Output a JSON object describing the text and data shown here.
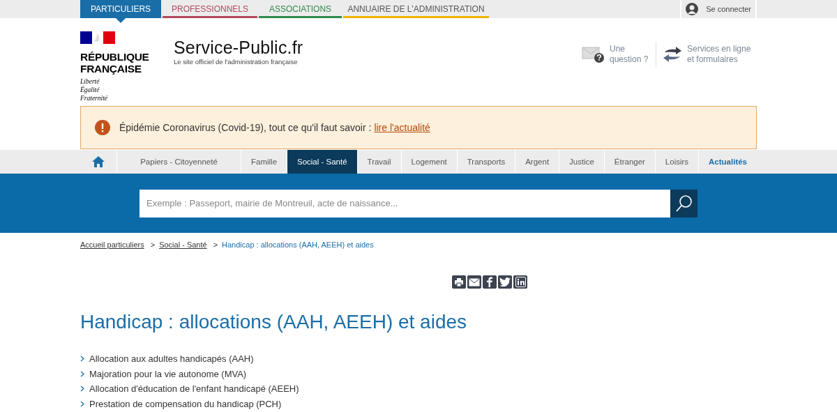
{
  "audience_tabs": [
    {
      "label": "PARTICULIERS",
      "selected": true,
      "color": "#1a6ea8"
    },
    {
      "label": "PROFESSIONNELS",
      "selected": false,
      "color": "#b5475e"
    },
    {
      "label": "ASSOCIATIONS",
      "selected": false,
      "color": "#2e8b4c"
    },
    {
      "label": "ANNUAIRE DE L'ADMINISTRATION",
      "selected": false,
      "color": "#f0b400",
      "kind": "neutral"
    }
  ],
  "login": {
    "label": "Se connecter"
  },
  "logo": {
    "republic": [
      "RÉPUBLIQUE",
      "FRANÇAISE"
    ],
    "motto": [
      "Liberté",
      "Égalité",
      "Fraternité"
    ]
  },
  "site": {
    "name": "Service-Public",
    "tld": ".fr",
    "tagline": "Le site officiel de l'administration française"
  },
  "header_links": [
    {
      "kind": "question",
      "label": "Une question ?"
    },
    {
      "kind": "services",
      "label": "Services en ligne et formulaires"
    }
  ],
  "alert": {
    "text": "Épidémie Coronavirus (Covid-19), tout ce qu'il faut savoir :",
    "link": "lire l'actualité"
  },
  "nav": [
    {
      "kind": "home",
      "selected": false
    },
    {
      "kind": "theme",
      "label": "Papiers - Citoyenneté",
      "selected": false
    },
    {
      "kind": "theme",
      "label": "Famille",
      "selected": false
    },
    {
      "kind": "theme",
      "label": "Social - Santé",
      "selected": true
    },
    {
      "kind": "theme",
      "label": "Travail",
      "selected": false
    },
    {
      "kind": "theme",
      "label": "Logement",
      "selected": false
    },
    {
      "kind": "theme",
      "label": "Transports",
      "selected": false
    },
    {
      "kind": "theme",
      "label": "Argent",
      "selected": false
    },
    {
      "kind": "theme",
      "label": "Justice",
      "selected": false
    },
    {
      "kind": "theme",
      "label": "Étranger",
      "selected": false
    },
    {
      "kind": "theme",
      "label": "Loisirs",
      "selected": false
    },
    {
      "kind": "news",
      "label": "Actualités",
      "selected": false
    }
  ],
  "search": {
    "placeholder": "Exemple : Passeport, mairie de Montreuil, acte de naissance..."
  },
  "breadcrumb": [
    {
      "label": "Accueil particuliers",
      "current": false
    },
    {
      "label": "Social - Santé",
      "current": false
    },
    {
      "label": "Handicap : allocations (AAH, AEEH) et aides",
      "current": true
    }
  ],
  "breadcrumb_separator": ">",
  "share": [
    {
      "kind": "print"
    },
    {
      "kind": "email"
    },
    {
      "kind": "facebook"
    },
    {
      "kind": "twitter"
    },
    {
      "kind": "linkedin"
    }
  ],
  "title": "Handicap : allocations (AAH, AEEH) et aides",
  "links": [
    "Allocation aux adultes handicapés (AAH)",
    "Majoration pour la vie autonome (MVA)",
    "Allocation d'éducation de l'enfant handicapé (AEEH)",
    "Prestation de compensation du handicap (PCH)"
  ]
}
